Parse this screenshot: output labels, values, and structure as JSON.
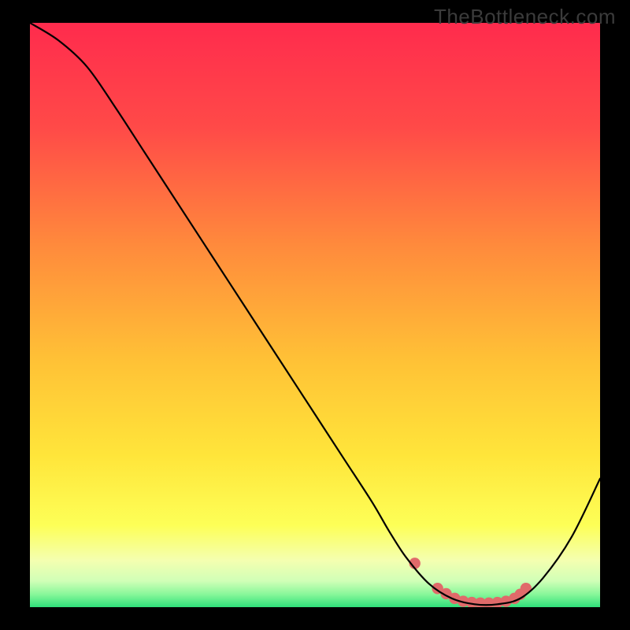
{
  "watermark": "TheBottleneck.com",
  "chart_data": {
    "type": "line",
    "title": "",
    "xlabel": "",
    "ylabel": "",
    "x_range": [
      0,
      100
    ],
    "y_range": [
      0,
      100
    ],
    "series": [
      {
        "name": "curve",
        "color": "#000000",
        "x": [
          0,
          5,
          10,
          15,
          20,
          25,
          30,
          35,
          40,
          45,
          50,
          55,
          60,
          63,
          66,
          70,
          74,
          78,
          82,
          86,
          90,
          95,
          100
        ],
        "y": [
          100,
          97,
          92.5,
          85.5,
          78,
          70.5,
          63,
          55.5,
          48,
          40.5,
          33,
          25.5,
          18,
          13,
          8.5,
          4,
          1.5,
          0.5,
          0.5,
          1.5,
          5,
          12,
          22
        ]
      },
      {
        "name": "dots",
        "color": "#e06a6a",
        "type": "scatter",
        "x": [
          67.5,
          71.5,
          73,
          74.5,
          76,
          77.5,
          79,
          80.5,
          82,
          83.5,
          85,
          86,
          87
        ],
        "y": [
          7.5,
          3.2,
          2.3,
          1.5,
          1,
          0.8,
          0.7,
          0.7,
          0.8,
          1,
          1.5,
          2.2,
          3.2
        ]
      }
    ],
    "background_gradient": {
      "type": "vertical",
      "stops": [
        {
          "offset": 0.0,
          "color": "#ff2b4d"
        },
        {
          "offset": 0.18,
          "color": "#ff4a48"
        },
        {
          "offset": 0.38,
          "color": "#ff8a3c"
        },
        {
          "offset": 0.58,
          "color": "#ffc236"
        },
        {
          "offset": 0.74,
          "color": "#ffe53a"
        },
        {
          "offset": 0.86,
          "color": "#fdff57"
        },
        {
          "offset": 0.92,
          "color": "#f4ffb0"
        },
        {
          "offset": 0.955,
          "color": "#d1ffb7"
        },
        {
          "offset": 0.978,
          "color": "#88f79a"
        },
        {
          "offset": 1.0,
          "color": "#2fe07a"
        }
      ]
    }
  }
}
